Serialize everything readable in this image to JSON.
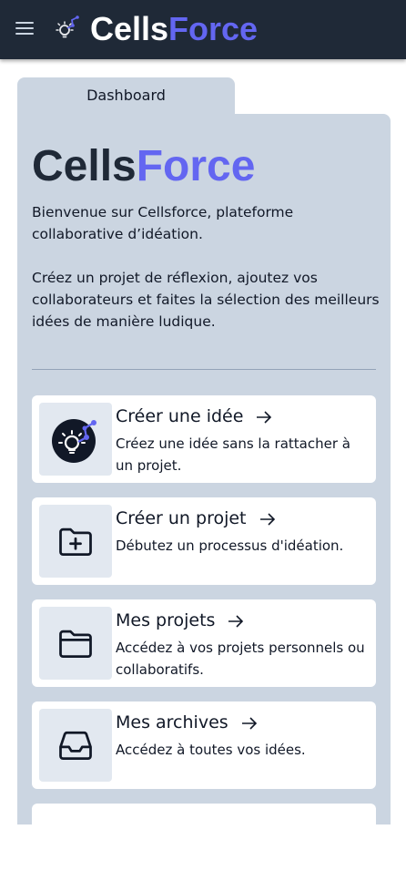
{
  "app": {
    "brand_part1": "Cells",
    "brand_part2": "Force",
    "brand_color": "#6366f1",
    "topbar_color": "#1f2937"
  },
  "tab": {
    "label": "Dashboard"
  },
  "hero": {
    "title_part1": "Cells",
    "title_part2": "Force",
    "intro_1": "Bienvenue sur Cellsforce, plateforme collaborative d’idéation.",
    "intro_2": "Créez un projet de réflexion, ajoutez vos collaborateurs et faites la sélection des meilleurs idées de manière ludique."
  },
  "cards": [
    {
      "title": "Créer une idée",
      "description": "Créez une idée sans la rattacher à un projet.",
      "icon": "idea-logo-icon"
    },
    {
      "title": "Créer un projet",
      "description": "Débutez un processus d'idéation.",
      "icon": "folder-plus-icon"
    },
    {
      "title": "Mes projets",
      "description": "Accédez à vos projets personnels ou collaboratifs.",
      "icon": "folder-icon"
    },
    {
      "title": "Mes archives",
      "description": "Accédez à toutes vos idées.",
      "icon": "inbox-icon"
    }
  ]
}
